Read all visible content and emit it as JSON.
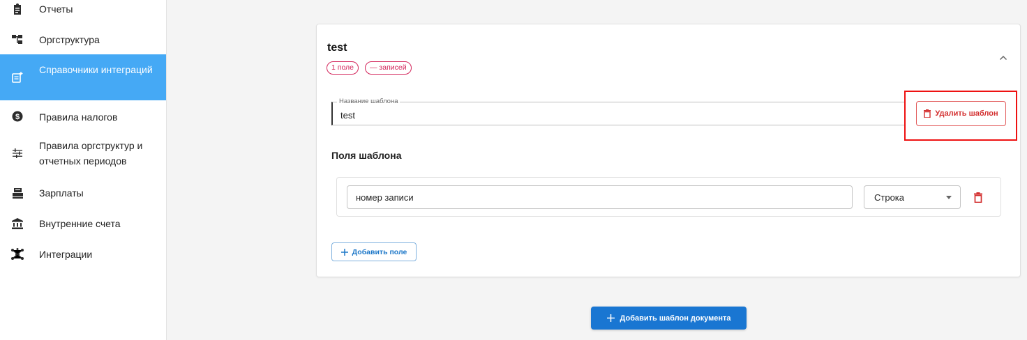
{
  "sidebar": {
    "items": [
      {
        "label": "Отчеты",
        "icon": "clipboard-icon"
      },
      {
        "label": "Оргструктура",
        "icon": "org-structure-icon"
      },
      {
        "label": "Справочники интеграций",
        "icon": "integration-reference-icon",
        "active": true
      },
      {
        "label": "Правила налогов",
        "icon": "dollar-circle-icon"
      },
      {
        "label": "Правила оргструктур и отчетных периодов",
        "icon": "sliders-icon"
      },
      {
        "label": "Зарплаты",
        "icon": "payroll-icon"
      },
      {
        "label": "Внутренние счета",
        "icon": "bank-icon"
      },
      {
        "label": "Интеграции",
        "icon": "network-icon"
      }
    ]
  },
  "template": {
    "title": "test",
    "chip_fields": "1 поле",
    "chip_records": "— записей",
    "name_field_label": "Название шаблона",
    "name_field_value": "test",
    "delete_label": "Удалить шаблон",
    "fields_section_title": "Поля шаблона",
    "fields": [
      {
        "name": "номер записи",
        "type": "Строка"
      }
    ],
    "add_field_label": "Добавить поле"
  },
  "add_template_label": "Добавить шаблон документа",
  "colors": {
    "active_nav": "#45a9f5",
    "danger": "#d32f2f",
    "chip": "#d3245a",
    "primary": "#1976d2",
    "highlight": "#ee1111"
  }
}
